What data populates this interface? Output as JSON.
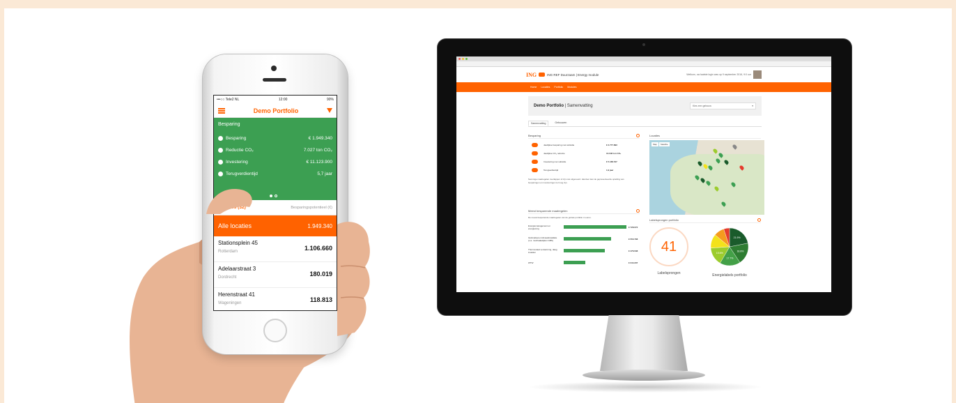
{
  "phone": {
    "status": {
      "carrier": "•••○○ Tele2 NL",
      "time": "12:00",
      "battery": "90%"
    },
    "app_title": "Demo Portfolio",
    "savings_card": {
      "heading": "Besparing",
      "rows": [
        {
          "label": "Besparing",
          "value": "€ 1.949.340"
        },
        {
          "label": "Reductie CO₂",
          "value": "7.027 ton CO₂"
        },
        {
          "label": "Investering",
          "value": "€ 11.123.900"
        },
        {
          "label": "Terugverdientijd",
          "value": "5,7 jaar"
        }
      ]
    },
    "locations_header": {
      "label": "Locaties (32)",
      "sort": "Besparingspotentieel (€)"
    },
    "all_locations": {
      "label": "Alle locaties",
      "value": "1.949.340"
    },
    "locations": [
      {
        "name": "Stationsplein 45",
        "city": "Rotterdam",
        "value": "1.106.660"
      },
      {
        "name": "Adelaarstraat 3",
        "city": "Dordrecht",
        "value": "180.019"
      },
      {
        "name": "Herenstraat 41",
        "city": "Wageningen",
        "value": "118.813"
      }
    ]
  },
  "web": {
    "brand": "ING",
    "header_title": "ING REF Duurzaam | Energy module",
    "welcome": "Welkom, uw laatste login was op 9 september 2016, 9:0 uur",
    "nav": [
      "Home",
      "Locaties",
      "Portfolio",
      "Modules"
    ],
    "page_title": "Demo Portfolio",
    "page_subtitle": "| Samenvatting",
    "select_placeholder": "Kies een gebouw",
    "tabs": [
      "Samenvatting",
      "Gebouwen"
    ],
    "besparing": {
      "heading": "Besparing",
      "rows": [
        {
          "label": "Jaarlijkse besparing met subsidie",
          "value": "€ 2.777.893"
        },
        {
          "label": "Jaarlijkse CO₂ reductie",
          "value": "10.048 ton CO₂"
        },
        {
          "label": "Investering met subsidie",
          "value": "€ 5.188.547"
        },
        {
          "label": "Terugverdientijd",
          "value": "1,9 jaar"
        }
      ],
      "note": "Sommige maatregelen overlappen of zijn niet uitgevoerd. Hierdoor kan de gepresenteerde optelling van besparingen en investeringen te hoog zijn."
    },
    "locaties": {
      "heading": "Locaties",
      "map_buttons": [
        "Map",
        "Satellite"
      ]
    },
    "measures": {
      "heading": "Meest besparende maatregelen",
      "sub": "De meest besparende maatregelen van de gehele portfolio in euros.",
      "rows": [
        {
          "label": "Energiemanagement en energiezorg",
          "value": "€ 728.072",
          "fraction": 1.0
        },
        {
          "label": "Optimaliseren klimaatinstallatie (o.a. muchaakelijden GBS)",
          "value": "€ 550.708",
          "fraction": 0.76
        },
        {
          "label": "Thermostaat verwarming, daag instellen",
          "value": "€ 476.538",
          "fraction": 0.65
        },
        {
          "label": "WTW",
          "value": "€ 244.237",
          "fraction": 0.34
        }
      ]
    },
    "labelsprongen": {
      "heading": "Labelsprongen portfolio",
      "count": "41",
      "count_caption": "Labelsprongen",
      "pie_caption": "Energielabels portfolio"
    },
    "pie": [
      {
        "label": "21.9%",
        "fraction": 0.219,
        "color": "#1a5b2b"
      },
      {
        "label": "18.8%",
        "fraction": 0.188,
        "color": "#2e7d32"
      },
      {
        "label": "17.7%",
        "fraction": 0.177,
        "color": "#43a047"
      },
      {
        "label": "15.6%",
        "fraction": 0.156,
        "color": "#9ccc2d"
      },
      {
        "label": "",
        "fraction": 0.12,
        "color": "#f3e21b"
      },
      {
        "label": "",
        "fraction": 0.09,
        "color": "#f59b1e"
      },
      {
        "label": "",
        "fraction": 0.05,
        "color": "#e53b2c"
      }
    ]
  },
  "colors": {
    "orange": "#ff6200",
    "green": "#3c9f52"
  }
}
